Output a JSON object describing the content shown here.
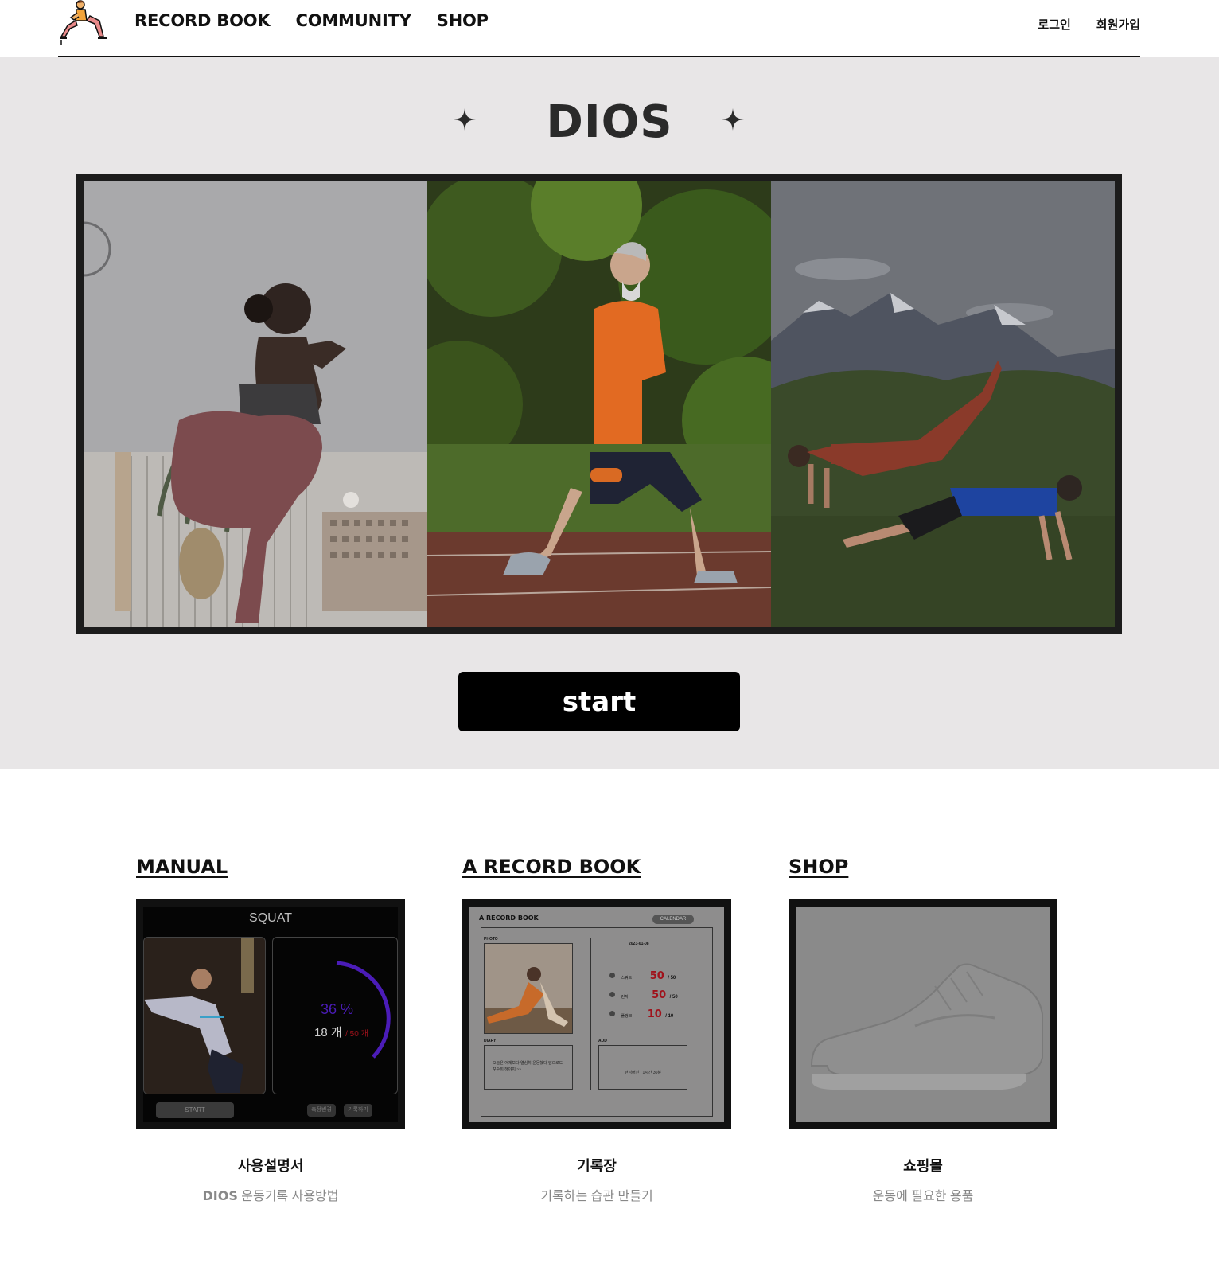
{
  "nav": {
    "items": [
      "RECORD BOOK",
      "COMMUNITY",
      "SHOP"
    ],
    "login": "로그인",
    "signup": "회원가입"
  },
  "hero": {
    "title": "DIOS",
    "start_label": "start"
  },
  "cards": [
    {
      "heading": "MANUAL",
      "title": "사용설명서",
      "sub_brand": "DIOS",
      "sub_text": "운동기록 사용방법",
      "preview": {
        "exercise": "SQUAT",
        "percent": "36 %",
        "count": "18 개",
        "target": "/ 50 개",
        "start": "START",
        "btn1": "측정변경",
        "btn2": "기록하기"
      }
    },
    {
      "heading": "A RECORD BOOK",
      "title": "기록장",
      "sub_text": "기록하는 습관 만들기",
      "preview": {
        "title": "A RECORD BOOK",
        "calendar": "CALENDAR",
        "photo_label": "PHOTO",
        "date": "2023-01-08",
        "rows": [
          {
            "name": "스쿼트",
            "value": "50",
            "target": "/ 50"
          },
          {
            "name": "런지",
            "value": "50",
            "target": "/ 50"
          },
          {
            "name": "플랭크",
            "value": "10",
            "target": "/ 10"
          }
        ],
        "diary_label": "DIARY",
        "diary_text": "오늘은 어제보다 열심히 운동했다 앞으로도 꾸준히 해야지 ~~",
        "add_label": "ADD",
        "add_text": "런닝머신 : 1시간 30분"
      }
    },
    {
      "heading": "SHOP",
      "title": "쇼핑몰",
      "sub_text": "운동에 필요한 용품"
    }
  ],
  "colors": {
    "hero_bg": "#e8e6e7",
    "button_bg": "#000000",
    "accent_red": "#c8141e",
    "accent_purple": "#5a1ec8"
  }
}
